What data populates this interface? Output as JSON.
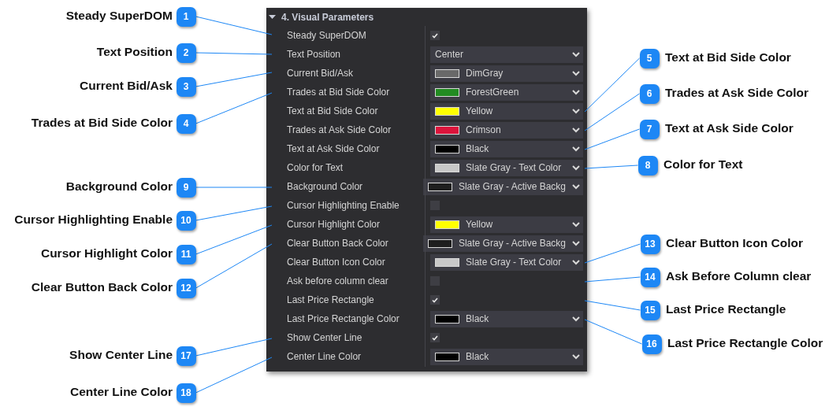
{
  "panel": {
    "title": "4. Visual Parameters",
    "expanded": true,
    "rows": [
      {
        "label": "Steady SuperDOM",
        "kind": "check",
        "checked": true
      },
      {
        "label": "Text Position",
        "kind": "select",
        "value": "Center"
      },
      {
        "label": "Current Bid/Ask",
        "kind": "color",
        "value": "DimGray",
        "color": "#696969"
      },
      {
        "label": "Trades at Bid Side Color",
        "kind": "color",
        "value": "ForestGreen",
        "color": "#228b22"
      },
      {
        "label": "Text at Bid Side Color",
        "kind": "color",
        "value": "Yellow",
        "color": "#ffff00"
      },
      {
        "label": "Trades at Ask Side Color",
        "kind": "color",
        "value": "Crimson",
        "color": "#dc143c"
      },
      {
        "label": "Text at Ask Side Color",
        "kind": "color",
        "value": "Black",
        "color": "#000000"
      },
      {
        "label": "Color for Text",
        "kind": "color",
        "value": "Slate Gray - Text Color",
        "color": "#c8c8c8"
      },
      {
        "label": "Background Color",
        "kind": "color",
        "value": "Slate Gray - Active Backg",
        "color": "#1e1e1e"
      },
      {
        "label": "Cursor Highlighting Enable",
        "kind": "check",
        "checked": false
      },
      {
        "label": "Cursor Highlight Color",
        "kind": "color",
        "value": "Yellow",
        "color": "#ffff00"
      },
      {
        "label": "Clear Button Back Color",
        "kind": "color",
        "value": "Slate Gray - Active Backg",
        "color": "#1e1e1e"
      },
      {
        "label": "Clear Button Icon Color",
        "kind": "color",
        "value": "Slate Gray - Text Color",
        "color": "#c8c8c8"
      },
      {
        "label": "Ask before column clear",
        "kind": "check",
        "checked": false
      },
      {
        "label": "Last Price Rectangle",
        "kind": "check",
        "checked": true
      },
      {
        "label": "Last Price Rectangle Color",
        "kind": "color",
        "value": "Black",
        "color": "#000000"
      },
      {
        "label": "Show Center Line",
        "kind": "check",
        "checked": true
      },
      {
        "label": "Center Line Color",
        "kind": "color",
        "value": "Black",
        "color": "#000000"
      }
    ]
  },
  "callouts": [
    {
      "number": "1",
      "label": "Steady SuperDOM"
    },
    {
      "number": "2",
      "label": "Text Position"
    },
    {
      "number": "3",
      "label": "Current Bid/Ask"
    },
    {
      "number": "4",
      "label": "Trades at Bid Side Color"
    },
    {
      "number": "5",
      "label": "Text at Bid Side Color"
    },
    {
      "number": "6",
      "label": "Trades at Ask Side Color"
    },
    {
      "number": "7",
      "label": "Text at Ask Side Color"
    },
    {
      "number": "8",
      "label": "Color for Text"
    },
    {
      "number": "9",
      "label": "Background Color"
    },
    {
      "number": "10",
      "label": "Cursor Highlighting Enable"
    },
    {
      "number": "11",
      "label": "Cursor Highlight Color"
    },
    {
      "number": "12",
      "label": "Clear Button Back Color"
    },
    {
      "number": "13",
      "label": "Clear Button Icon Color"
    },
    {
      "number": "14",
      "label": "Ask Before Column clear"
    },
    {
      "number": "15",
      "label": "Last Price Rectangle"
    },
    {
      "number": "16",
      "label": "Last Price Rectangle Color"
    },
    {
      "number": "17",
      "label": "Show Center Line"
    },
    {
      "number": "18",
      "label": "Center Line Color"
    }
  ]
}
